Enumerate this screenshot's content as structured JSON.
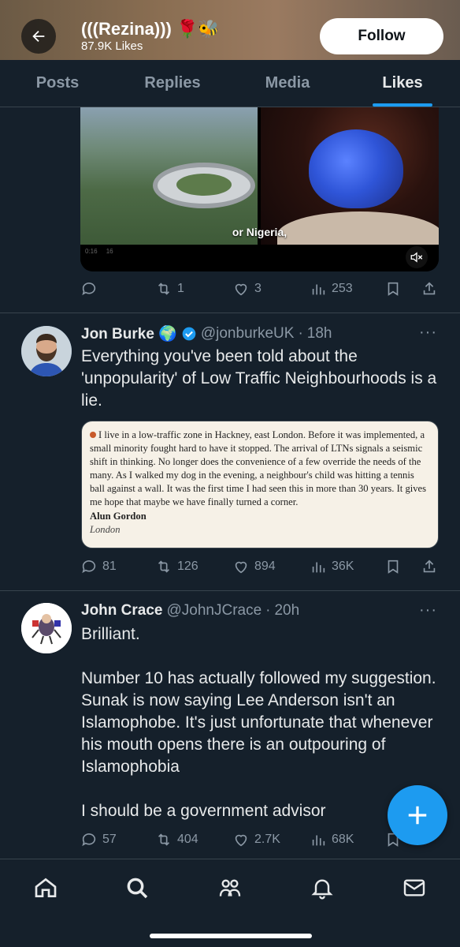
{
  "header": {
    "title": "(((Rezina))) 🌹🐝",
    "subtitle": "87.9K Likes",
    "follow_label": "Follow"
  },
  "tabs": [
    {
      "label": "Posts"
    },
    {
      "label": "Replies"
    },
    {
      "label": "Media"
    },
    {
      "label": "Likes",
      "active": true
    }
  ],
  "video_tweet": {
    "caption": "or Nigeria,",
    "time_left": "0:16",
    "time_mid": "16",
    "actions": {
      "replies": "",
      "reposts": "1",
      "likes": "3",
      "views": "253"
    }
  },
  "tweet1": {
    "name": "Jon Burke 🌍",
    "handle": "@jonburkeUK",
    "time": "18h",
    "more": "···",
    "text": "Everything you've been told about the 'unpopularity' of Low Traffic Neighbourhoods is a lie.",
    "quote": {
      "body": "I live in a low-traffic zone in Hackney, east London. Before it was implemented, a small minority fought hard to have it stopped. The arrival of LTNs signals a seismic shift in thinking. No longer does the convenience of a few override the needs of the many. As I walked my dog in the evening, a neighbour's child was hitting a tennis ball against a wall. It was the first time I had seen this in more than 30 years. It gives me hope that maybe we have finally turned a corner.",
      "author": "Alun Gordon",
      "location": "London"
    },
    "actions": {
      "replies": "81",
      "reposts": "126",
      "likes": "894",
      "views": "36K"
    }
  },
  "tweet2": {
    "name": "John Crace",
    "handle": "@JohnJCrace",
    "time": "20h",
    "more": "···",
    "text": "Brilliant.\n\nNumber 10 has actually followed my suggestion. Sunak is now saying Lee Anderson isn't an Islamophobe. It's just unfortunate that whenever his mouth opens there is an outpouring of Islamophobia\n\nI should be a government advisor",
    "actions": {
      "replies": "57",
      "reposts": "404",
      "likes": "2.7K",
      "views": "68K"
    }
  },
  "icons": {
    "accent": "#1d9bf0",
    "background": "#15202b"
  },
  "nav": [
    "home-icon",
    "search-icon",
    "communities-icon",
    "notifications-icon",
    "messages-icon"
  ]
}
